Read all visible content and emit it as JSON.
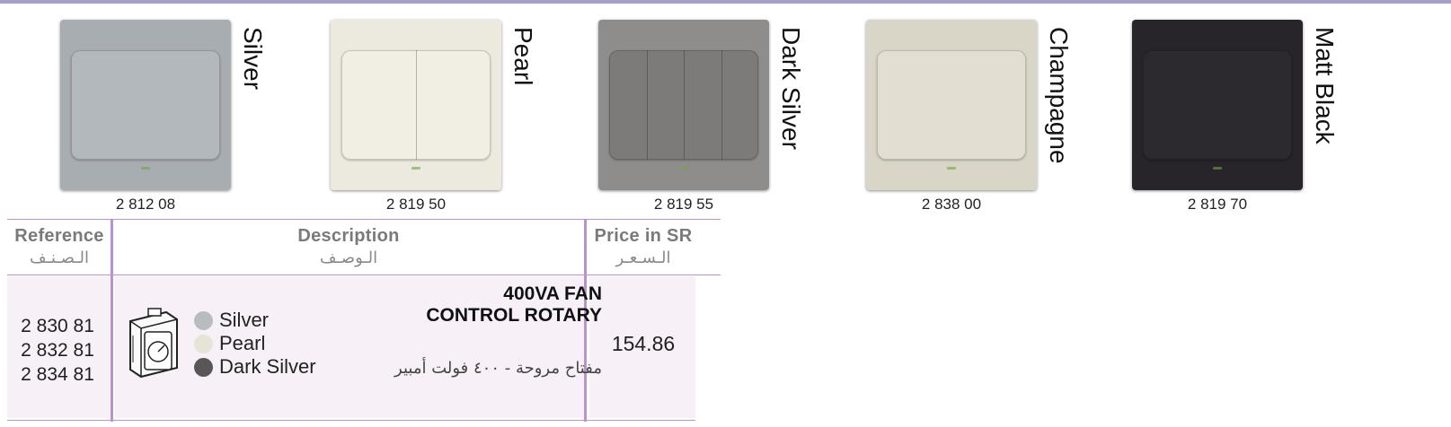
{
  "swatches": [
    {
      "name": "Silver",
      "ref": "2 812 08",
      "plate": "#a8adb2",
      "rocker": "#b3b8bc",
      "segments": 1
    },
    {
      "name": "Pearl",
      "ref": "2 819 50",
      "plate": "#ece9de",
      "rocker": "#f1eee4",
      "segments": 2
    },
    {
      "name": "Dark Silver",
      "ref": "2 819 55",
      "plate": "#8e8d8c",
      "rocker": "#7c7b7a",
      "segments": 4
    },
    {
      "name": "Champagne",
      "ref": "2 838 00",
      "plate": "#d9d6c8",
      "rocker": "#e2dfd2",
      "segments": 1
    },
    {
      "name": "Matt Black",
      "ref": "2 819 70",
      "plate": "#27242a",
      "rocker": "#2c292f",
      "segments": 1
    }
  ],
  "table": {
    "headers": {
      "reference_en": "Reference",
      "reference_ar": "الـصـنـف",
      "description_en": "Description",
      "description_ar": "الـوصـف",
      "price_en": "Price in SR",
      "price_ar": "الـسـعـر"
    },
    "row": {
      "references": [
        "2 830 81",
        "2 832 81",
        "2 834 81"
      ],
      "title_line1": "400VA FAN",
      "title_line2": "CONTROL ROTARY",
      "title_ar": "مفتاح مروحة - ٤٠٠ فولت أمبير",
      "colors": [
        {
          "label": "Silver",
          "color": "#b9bcbf"
        },
        {
          "label": "Pearl",
          "color": "#e6e4d6"
        },
        {
          "label": "Dark Silver",
          "color": "#5a5657"
        }
      ],
      "price": "154.86"
    }
  },
  "colors": {
    "accent_rule": "#a79ec7",
    "table_line": "#b993c9",
    "row_bg": "#f7f1f7"
  }
}
